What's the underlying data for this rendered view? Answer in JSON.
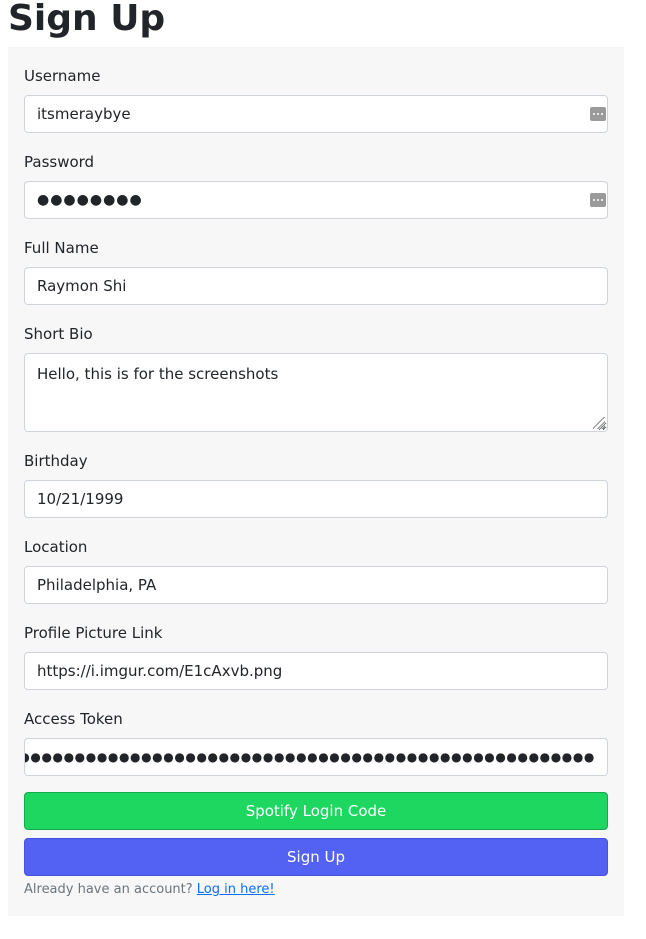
{
  "page": {
    "title": "Sign Up"
  },
  "form": {
    "username": {
      "label": "Username",
      "value": "itsmeraybye"
    },
    "password": {
      "label": "Password",
      "value": "●●●●●●●●"
    },
    "full_name": {
      "label": "Full Name",
      "value": "Raymon Shi"
    },
    "short_bio": {
      "label": "Short Bio",
      "value": "Hello, this is for the screenshots"
    },
    "birthday": {
      "label": "Birthday",
      "value": "10/21/1999"
    },
    "location": {
      "label": "Location",
      "value": "Philadelphia, PA"
    },
    "profile_picture": {
      "label": "Profile Picture Link",
      "value": "https://i.imgur.com/E1cAxvb.png"
    },
    "access_token": {
      "label": "Access Token",
      "value": "●●●●●●●●●●●●●●●●●●●●●●●●●●●●●●●●●●●●●●●●●●●●●●●●●●●●●●●●●●●●●●●●●●●●●●●●●●●●●●●●"
    },
    "spotify_button_label": "Spotify Login Code",
    "signup_button_label": "Sign Up",
    "footer_text": "Already have an account? ",
    "login_link_label": "Log in here!"
  },
  "colors": {
    "card_background": "#f7f7f8",
    "spotify_green": "#1ed760",
    "signup_blue": "#5362f2",
    "link_blue": "#0d6efd",
    "muted_text": "#6c757d"
  },
  "icons": {
    "password_manager": "password-manager-icon",
    "resize": "resize-grip-icon"
  }
}
